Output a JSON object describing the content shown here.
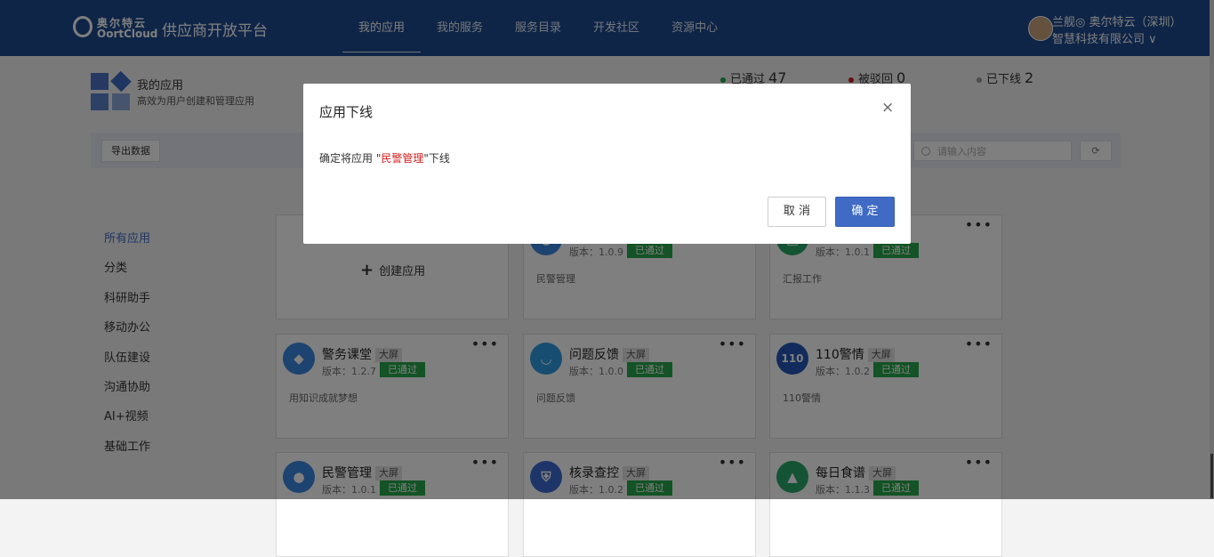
{
  "header": {
    "logo_cn": "奥尔特云",
    "logo_en": "OortCloud",
    "platform_title": "供应商开放平台",
    "nav": [
      {
        "label": "我的应用",
        "active": true
      },
      {
        "label": "我的服务"
      },
      {
        "label": "服务目录"
      },
      {
        "label": "开发社区"
      },
      {
        "label": "资源中心"
      }
    ],
    "user_line1": "兰舰◎ 奥尔特云（深圳）",
    "user_line2": "智慧科技有限公司 ∨"
  },
  "summary": {
    "title": "我的应用",
    "subtitle": "高效为用户创建和管理应用",
    "stats": [
      {
        "label": "已通过",
        "count": "47",
        "color": "#27a64a"
      },
      {
        "label": "被驳回",
        "count": "0",
        "color": "#d42020"
      },
      {
        "label": "已下线",
        "count": "2",
        "color": "#999999"
      }
    ]
  },
  "toolbar": {
    "export_label": "导出数据",
    "search_placeholder": "请输入内容"
  },
  "sidebar": {
    "items": [
      {
        "label": "所有应用",
        "active": true
      },
      {
        "label": "分类"
      },
      {
        "label": "科研助手"
      },
      {
        "label": "移动办公"
      },
      {
        "label": "队伍建设"
      },
      {
        "label": "沟通协助"
      },
      {
        "label": "AI+视频"
      },
      {
        "label": "基础工作"
      }
    ]
  },
  "create_card": {
    "label": "创建应用"
  },
  "apps": [
    {
      "name": "",
      "tag": "",
      "version": "版本：1.0.9",
      "status": "已通过",
      "desc": "民警管理",
      "icon_color": "#3a86e0"
    },
    {
      "name": "",
      "tag": "",
      "version": "版本：1.0.1",
      "status": "已通过",
      "desc": "汇报工作",
      "icon_color": "#29a86a"
    },
    {
      "name": "警务课堂",
      "tag": "大屏",
      "version": "版本：1.2.7",
      "status": "已通过",
      "desc": "用知识成就梦想",
      "icon_color": "#3a86e0"
    },
    {
      "name": "问题反馈",
      "tag": "大屏",
      "version": "版本：1.0.0",
      "status": "已通过",
      "desc": "问题反馈",
      "icon_color": "#2f9be0"
    },
    {
      "name": "110警情",
      "tag": "大屏",
      "version": "版本：1.0.2",
      "status": "已通过",
      "desc": "110警情",
      "icon_color": "#2556b8"
    },
    {
      "name": "民警管理",
      "tag": "大屏",
      "version": "版本：1.0.1",
      "status": "已通过",
      "desc": "",
      "icon_color": "#3a86e0"
    },
    {
      "name": "核录查控",
      "tag": "大屏",
      "version": "版本：1.0.2",
      "status": "已通过",
      "desc": "",
      "icon_color": "#3a6ad0"
    },
    {
      "name": "每日食谱",
      "tag": "大屏",
      "version": "版本：1.1.3",
      "status": "已通过",
      "desc": "",
      "icon_color": "#29a86a"
    }
  ],
  "more_label": "•••",
  "modal": {
    "title": "应用下线",
    "close": "×",
    "body_prefix": "确定将应用 \"",
    "app_name": "民警管理",
    "body_suffix": "\"下线",
    "cancel_label": "取 消",
    "ok_label": "确 定"
  }
}
